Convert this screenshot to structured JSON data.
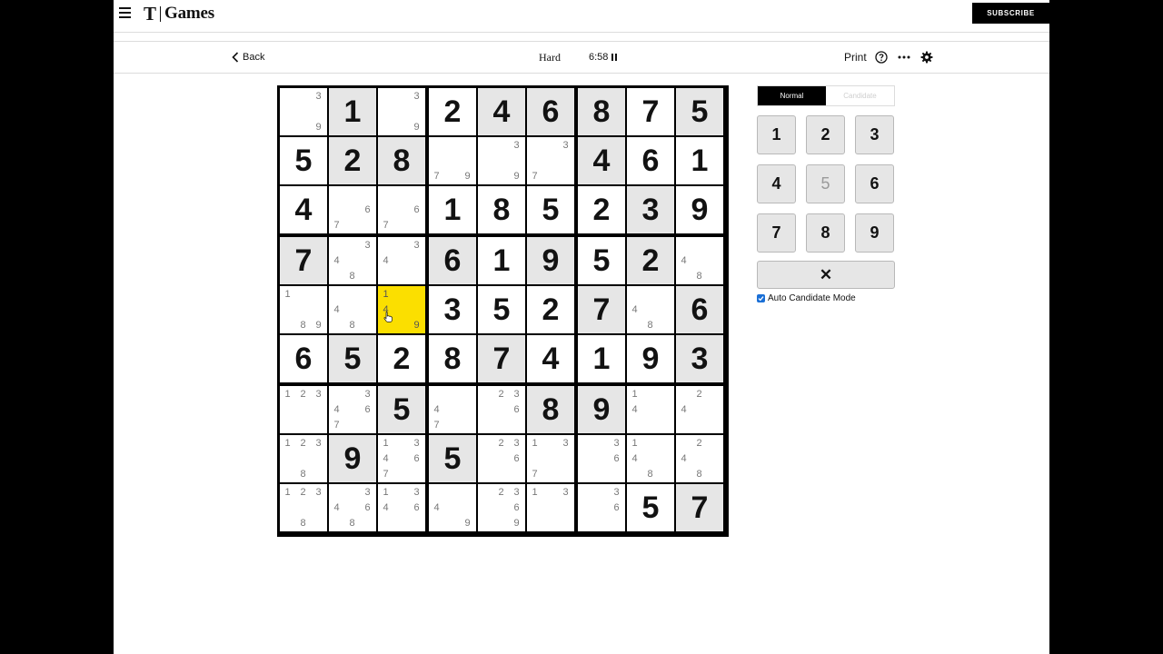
{
  "header": {
    "brand_letter": "T",
    "brand_name": "Games",
    "subscribe_label": "SUBSCRIBE"
  },
  "toolbar": {
    "back_label": "Back",
    "difficulty": "Hard",
    "timer": "6:58",
    "print_label": "Print"
  },
  "modes": {
    "normal_label": "Normal",
    "candidate_label": "Candidate"
  },
  "keypad": {
    "keys": [
      "1",
      "2",
      "3",
      "4",
      "5",
      "6",
      "7",
      "8",
      "9"
    ],
    "disabled": [
      "5"
    ],
    "erase_symbol": "✕"
  },
  "auto_candidate": {
    "label": "Auto Candidate Mode",
    "checked": true
  },
  "board": {
    "selected": [
      4,
      2
    ],
    "values": [
      [
        0,
        1,
        0,
        2,
        4,
        6,
        8,
        7,
        5
      ],
      [
        5,
        2,
        8,
        0,
        0,
        0,
        4,
        6,
        1
      ],
      [
        4,
        0,
        0,
        1,
        8,
        5,
        2,
        3,
        9
      ],
      [
        7,
        0,
        0,
        6,
        1,
        9,
        5,
        2,
        0
      ],
      [
        0,
        0,
        0,
        3,
        5,
        2,
        7,
        0,
        6
      ],
      [
        6,
        5,
        2,
        8,
        7,
        4,
        1,
        9,
        3
      ],
      [
        0,
        0,
        5,
        0,
        0,
        8,
        9,
        0,
        0
      ],
      [
        0,
        9,
        0,
        5,
        0,
        0,
        0,
        0,
        0
      ],
      [
        0,
        0,
        0,
        0,
        0,
        0,
        0,
        5,
        7
      ]
    ],
    "given": [
      [
        0,
        1,
        0,
        0,
        1,
        1,
        1,
        0,
        1
      ],
      [
        0,
        1,
        1,
        0,
        0,
        0,
        1,
        0,
        0
      ],
      [
        0,
        0,
        0,
        0,
        0,
        0,
        0,
        1,
        0
      ],
      [
        1,
        0,
        0,
        1,
        0,
        1,
        0,
        1,
        0
      ],
      [
        0,
        0,
        0,
        0,
        0,
        0,
        1,
        0,
        1
      ],
      [
        0,
        1,
        0,
        0,
        1,
        0,
        0,
        0,
        1
      ],
      [
        0,
        0,
        1,
        0,
        0,
        1,
        1,
        0,
        0
      ],
      [
        0,
        1,
        0,
        1,
        0,
        0,
        0,
        0,
        0
      ],
      [
        0,
        0,
        0,
        0,
        0,
        0,
        0,
        0,
        1
      ]
    ],
    "candidates": [
      [
        [
          3,
          9
        ],
        [],
        [
          3,
          9
        ],
        [],
        [],
        [],
        [],
        [],
        []
      ],
      [
        [],
        [],
        [],
        [
          7,
          9
        ],
        [
          3,
          9
        ],
        [
          3,
          7
        ],
        [],
        [],
        []
      ],
      [
        [],
        [
          6,
          7
        ],
        [
          6,
          7
        ],
        [],
        [],
        [],
        [],
        [],
        []
      ],
      [
        [],
        [
          3,
          4,
          8
        ],
        [
          3,
          4
        ],
        [],
        [],
        [],
        [],
        [],
        [
          4,
          8
        ]
      ],
      [
        [
          1,
          8,
          9
        ],
        [
          4,
          8
        ],
        [
          1,
          4,
          9
        ],
        [],
        [],
        [],
        [],
        [
          4,
          8
        ],
        []
      ],
      [
        [],
        [],
        [],
        [],
        [],
        [],
        [],
        [],
        []
      ],
      [
        [
          1,
          2,
          3
        ],
        [
          3,
          4,
          6,
          7
        ],
        [],
        [
          4,
          7
        ],
        [
          2,
          3,
          6
        ],
        [],
        [],
        [
          1,
          4
        ],
        [
          2,
          4
        ]
      ],
      [
        [
          1,
          2,
          3,
          8
        ],
        [],
        [
          1,
          3,
          4,
          6,
          7
        ],
        [],
        [
          2,
          3,
          6
        ],
        [
          1,
          3,
          7
        ],
        [
          3,
          6
        ],
        [
          1,
          4,
          8
        ],
        [
          2,
          4,
          8
        ]
      ],
      [
        [
          1,
          2,
          3,
          8
        ],
        [
          3,
          4,
          6,
          8
        ],
        [
          1,
          3,
          4,
          6
        ],
        [
          4,
          9
        ],
        [
          2,
          3,
          6,
          9
        ],
        [
          1,
          3
        ],
        [
          3,
          6
        ],
        [],
        []
      ]
    ]
  }
}
